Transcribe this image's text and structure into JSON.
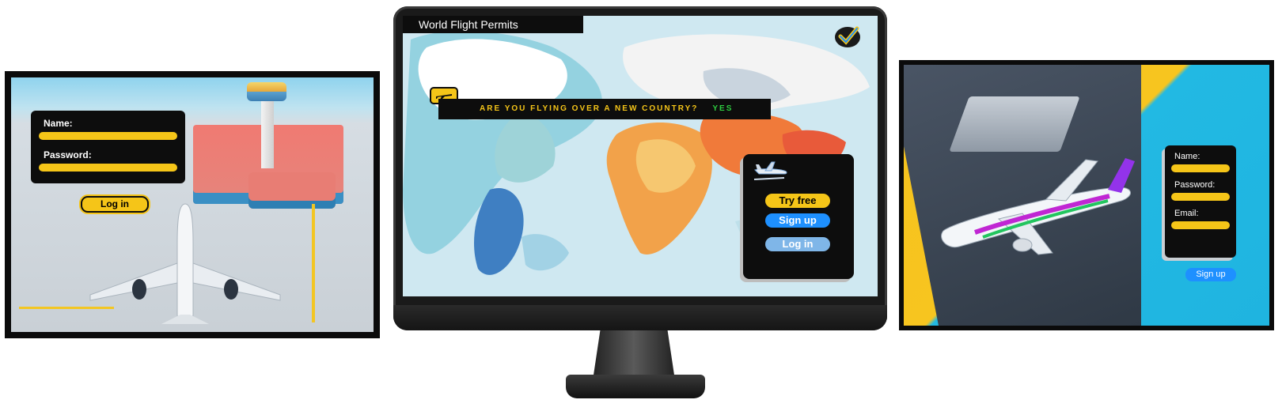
{
  "left_panel": {
    "name_label": "Name:",
    "password_label": "Password:",
    "login_button": "Log in"
  },
  "monitor": {
    "app_title": "World Flight Permits",
    "question": "ARE YOU FLYING OVER A NEW COUNTRY?",
    "answer": "YES",
    "try_free_button": "Try free",
    "sign_up_button": "Sign up",
    "log_in_button": "Log in"
  },
  "right_panel": {
    "name_label": "Name:",
    "password_label": "Password:",
    "email_label": "Email:",
    "sign_up_button": "Sign up"
  },
  "colors": {
    "accent_yellow": "#f5c518",
    "accent_blue": "#1e90ff",
    "light_blue": "#7fb6e8",
    "panel_black": "#0d0d0d",
    "answer_green": "#2ecc40"
  },
  "icons": [
    "airplane-icon",
    "checkmark-logo-icon"
  ]
}
